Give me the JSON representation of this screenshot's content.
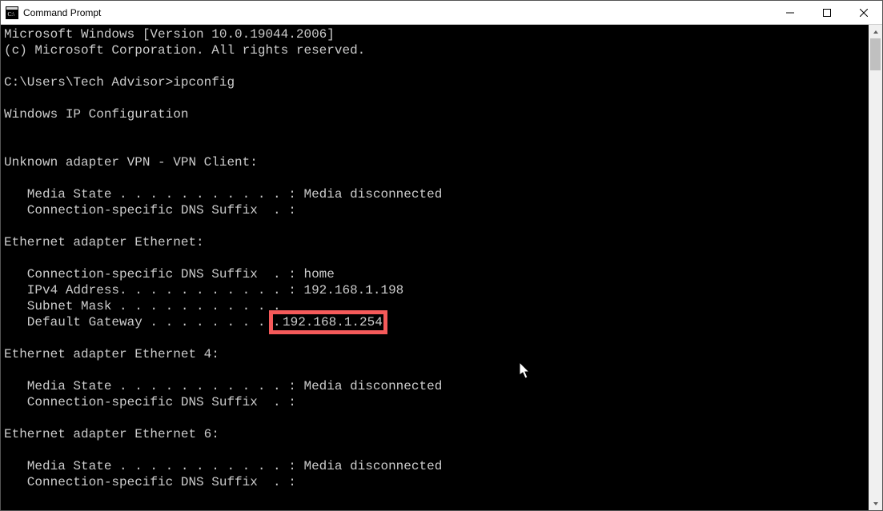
{
  "window": {
    "title": "Command Prompt"
  },
  "terminal": {
    "line1": "Microsoft Windows [Version 10.0.19044.2006]",
    "line2": "(c) Microsoft Corporation. All rights reserved.",
    "blank1": "",
    "prompt1": "C:\\Users\\Tech Advisor>ipconfig",
    "blank2": "",
    "header1": "Windows IP Configuration",
    "blank3": "",
    "blank4": "",
    "adapter1_title": "Unknown adapter VPN - VPN Client:",
    "blank5": "",
    "adapter1_media": "   Media State . . . . . . . . . . . : Media disconnected",
    "adapter1_dns": "   Connection-specific DNS Suffix  . :",
    "blank6": "",
    "adapter2_title": "Ethernet adapter Ethernet:",
    "blank7": "",
    "adapter2_dns": "   Connection-specific DNS Suffix  . : home",
    "adapter2_ipv4": "   IPv4 Address. . . . . . . . . . . : 192.168.1.198",
    "adapter2_subnet": "   Subnet Mask . . . . . . . . . . .",
    "adapter2_gw": "   Default Gateway . . . . . . . . .",
    "blank8": "",
    "adapter3_title": "Ethernet adapter Ethernet 4:",
    "blank9": "",
    "adapter3_media": "   Media State . . . . . . . . . . . : Media disconnected",
    "adapter3_dns": "   Connection-specific DNS Suffix  . :",
    "blank10": "",
    "adapter4_title": "Ethernet adapter Ethernet 6:",
    "blank11": "",
    "adapter4_media": "   Media State . . . . . . . . . . . : Media disconnected",
    "adapter4_dns": "   Connection-specific DNS Suffix  . :"
  },
  "highlight": {
    "gateway_value": "192.168.1.254"
  }
}
